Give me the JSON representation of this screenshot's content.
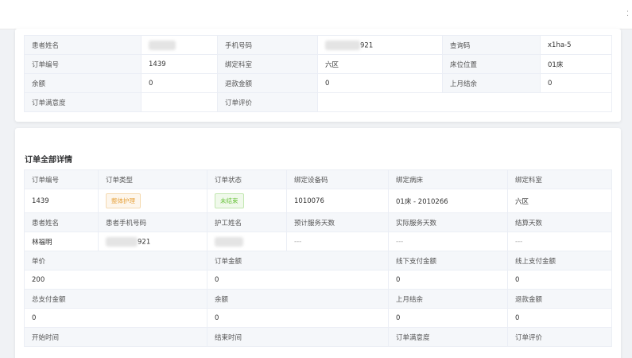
{
  "top_info": {
    "rows": [
      [
        {
          "label": "患者姓名",
          "value": ""
        },
        {
          "label": "手机号码",
          "value": "921"
        },
        {
          "label": "查询码",
          "value": "x1ha-5"
        }
      ],
      [
        {
          "label": "订单编号",
          "value": "1439"
        },
        {
          "label": "绑定科室",
          "value": "六区"
        },
        {
          "label": "床位位置",
          "value": "01床"
        }
      ],
      [
        {
          "label": "余额",
          "value": "0"
        },
        {
          "label": "退款金额",
          "value": "0"
        },
        {
          "label": "上月结余",
          "value": "0"
        }
      ],
      [
        {
          "label": "订单满意度",
          "value": ""
        },
        {
          "label": "订单评价",
          "value": ""
        }
      ]
    ]
  },
  "detail": {
    "title": "订单全部详情",
    "row1": {
      "headers": [
        "订单编号",
        "订单类型",
        "订单状态",
        "绑定设备码",
        "绑定病床",
        "绑定科室"
      ],
      "values": [
        "1439",
        "整体护理",
        "未结束",
        "1010076",
        "01床 - 2010266",
        "六区"
      ]
    },
    "row2": {
      "headers": [
        "患者姓名",
        "患者手机号码",
        "护工姓名",
        "预计服务天数",
        "实际服务天数",
        "结算天数"
      ],
      "values": [
        "林福明",
        "921",
        "",
        "---",
        "---",
        "---"
      ]
    },
    "row3": {
      "headers": [
        "单价",
        "订单金额",
        "线下支付金额",
        "线上支付金额"
      ],
      "values": [
        "200",
        "0",
        "0",
        "0"
      ]
    },
    "row4": {
      "headers": [
        "总支付金额",
        "余额",
        "上月结余",
        "退款金额"
      ],
      "values": [
        "0",
        "0",
        "0",
        "0"
      ]
    },
    "row5": {
      "headers": [
        "开始时间",
        "结束时间",
        "订单满意度",
        "订单评价"
      ]
    }
  },
  "colors": {
    "tag_orange": "#e6a23c",
    "tag_green": "#67c23a",
    "label_bg": "#f5f7fa",
    "border": "#ebeef5"
  },
  "icons": [
    "collapse-icon"
  ]
}
